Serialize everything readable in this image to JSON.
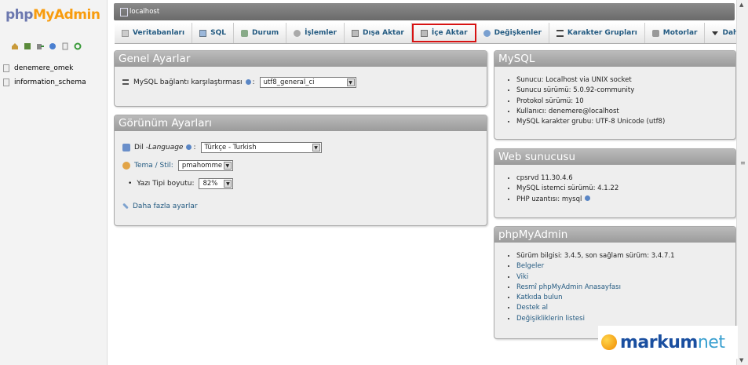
{
  "logo": {
    "php": "php",
    "myadmin": "MyAdmin"
  },
  "nav": {
    "icons": [
      "home-icon",
      "query-icon",
      "exit-icon",
      "help-icon",
      "docs-icon",
      "reload-icon"
    ],
    "databases": [
      "denemere_omek",
      "information_schema"
    ]
  },
  "server": {
    "label": "localhost"
  },
  "tabs": [
    {
      "label": "Veritabanları",
      "icon": "database-icon"
    },
    {
      "label": "SQL",
      "icon": "sql-icon"
    },
    {
      "label": "Durum",
      "icon": "status-icon"
    },
    {
      "label": "İşlemler",
      "icon": "process-icon"
    },
    {
      "label": "Dışa Aktar",
      "icon": "export-icon"
    },
    {
      "label": "İçe Aktar",
      "icon": "import-icon",
      "active": true
    },
    {
      "label": "Değişkenler",
      "icon": "variables-icon"
    },
    {
      "label": "Karakter Grupları",
      "icon": "charset-icon"
    },
    {
      "label": "Motorlar",
      "icon": "engines-icon"
    },
    {
      "label": "Daha Fazla",
      "icon": "more-icon"
    }
  ],
  "general": {
    "title": "Genel Ayarlar",
    "collation_label": "MySQL bağlantı karşılaştırması",
    "collation_value": "utf8_general_ci"
  },
  "appearance": {
    "title": "Görünüm Ayarları",
    "lang_label_prefix": "Dil - ",
    "lang_label_italic": "Language",
    "lang_value": "Türkçe - Turkish",
    "theme_label": "Tema / Stil:",
    "theme_value": "pmahomme",
    "font_label": "Yazı Tipi boyutu:",
    "font_value": "82%",
    "more_link": "Daha fazla ayarlar"
  },
  "mysql": {
    "title": "MySQL",
    "items": [
      "Sunucu: Localhost via UNIX socket",
      "Sunucu sürümü: 5.0.92-community",
      "Protokol sürümü: 10",
      "Kullanıcı: denemere@localhost",
      "MySQL karakter grubu: UTF-8 Unicode (utf8)"
    ]
  },
  "web": {
    "title": "Web sunucusu",
    "items": [
      "cpsrvd 11.30.4.6",
      "MySQL istemci sürümü: 4.1.22",
      "PHP uzantısı: mysql"
    ]
  },
  "pma": {
    "title": "phpMyAdmin",
    "version": "Sürüm bilgisi: 3.4.5, son sağlam sürüm: 3.4.7.1",
    "links": [
      "Belgeler",
      "Viki",
      "Resmî phpMyAdmin Anasayfası",
      "Katkıda bulun",
      "Destek al",
      "Değişikliklerin listesi"
    ]
  },
  "watermark": {
    "brand1": "markum",
    "brand2": "net"
  }
}
